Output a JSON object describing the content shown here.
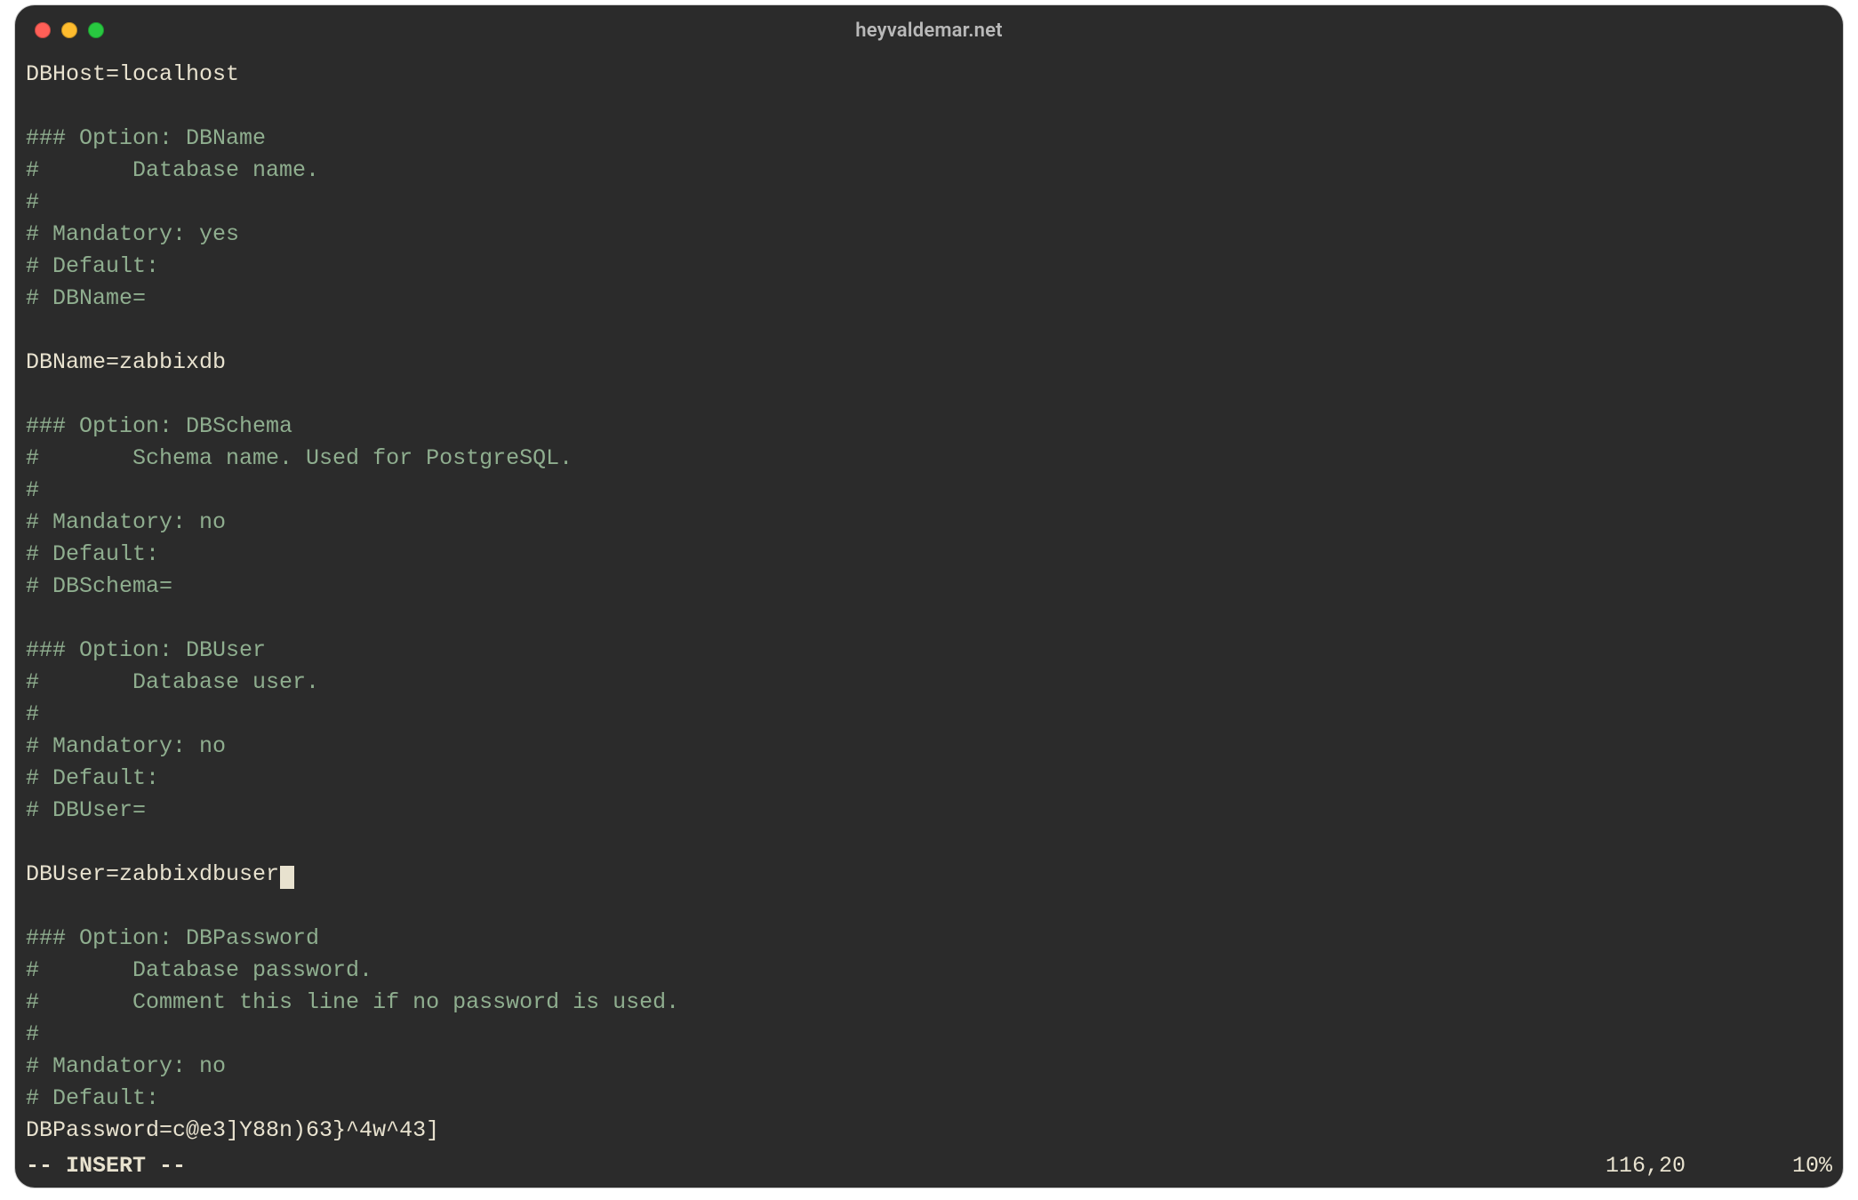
{
  "window": {
    "title": "heyvaldemar.net"
  },
  "editor": {
    "lines": [
      {
        "text": "DBHost=localhost",
        "cls": "setting"
      },
      {
        "text": "",
        "cls": "comment"
      },
      {
        "text": "### Option: DBName",
        "cls": "comment"
      },
      {
        "text": "#       Database name.",
        "cls": "comment"
      },
      {
        "text": "#",
        "cls": "comment"
      },
      {
        "text": "# Mandatory: yes",
        "cls": "comment"
      },
      {
        "text": "# Default:",
        "cls": "comment"
      },
      {
        "text": "# DBName=",
        "cls": "comment"
      },
      {
        "text": "",
        "cls": "comment"
      },
      {
        "text": "DBName=zabbixdb",
        "cls": "setting"
      },
      {
        "text": "",
        "cls": "comment"
      },
      {
        "text": "### Option: DBSchema",
        "cls": "comment"
      },
      {
        "text": "#       Schema name. Used for PostgreSQL.",
        "cls": "comment"
      },
      {
        "text": "#",
        "cls": "comment"
      },
      {
        "text": "# Mandatory: no",
        "cls": "comment"
      },
      {
        "text": "# Default:",
        "cls": "comment"
      },
      {
        "text": "# DBSchema=",
        "cls": "comment"
      },
      {
        "text": "",
        "cls": "comment"
      },
      {
        "text": "### Option: DBUser",
        "cls": "comment"
      },
      {
        "text": "#       Database user.",
        "cls": "comment"
      },
      {
        "text": "#",
        "cls": "comment"
      },
      {
        "text": "# Mandatory: no",
        "cls": "comment"
      },
      {
        "text": "# Default:",
        "cls": "comment"
      },
      {
        "text": "# DBUser=",
        "cls": "comment"
      },
      {
        "text": "",
        "cls": "comment"
      },
      {
        "text": "DBUser=zabbixdbuser",
        "cls": "setting",
        "cursor": true
      },
      {
        "text": "",
        "cls": "comment"
      },
      {
        "text": "### Option: DBPassword",
        "cls": "comment"
      },
      {
        "text": "#       Database password.",
        "cls": "comment"
      },
      {
        "text": "#       Comment this line if no password is used.",
        "cls": "comment"
      },
      {
        "text": "#",
        "cls": "comment"
      },
      {
        "text": "# Mandatory: no",
        "cls": "comment"
      },
      {
        "text": "# Default:",
        "cls": "comment"
      },
      {
        "text": "DBPassword=c@e3]Y88n)63}^4w^43]",
        "cls": "setting"
      }
    ]
  },
  "status": {
    "mode": "-- INSERT --",
    "position": "116,20",
    "percent": "10%"
  }
}
